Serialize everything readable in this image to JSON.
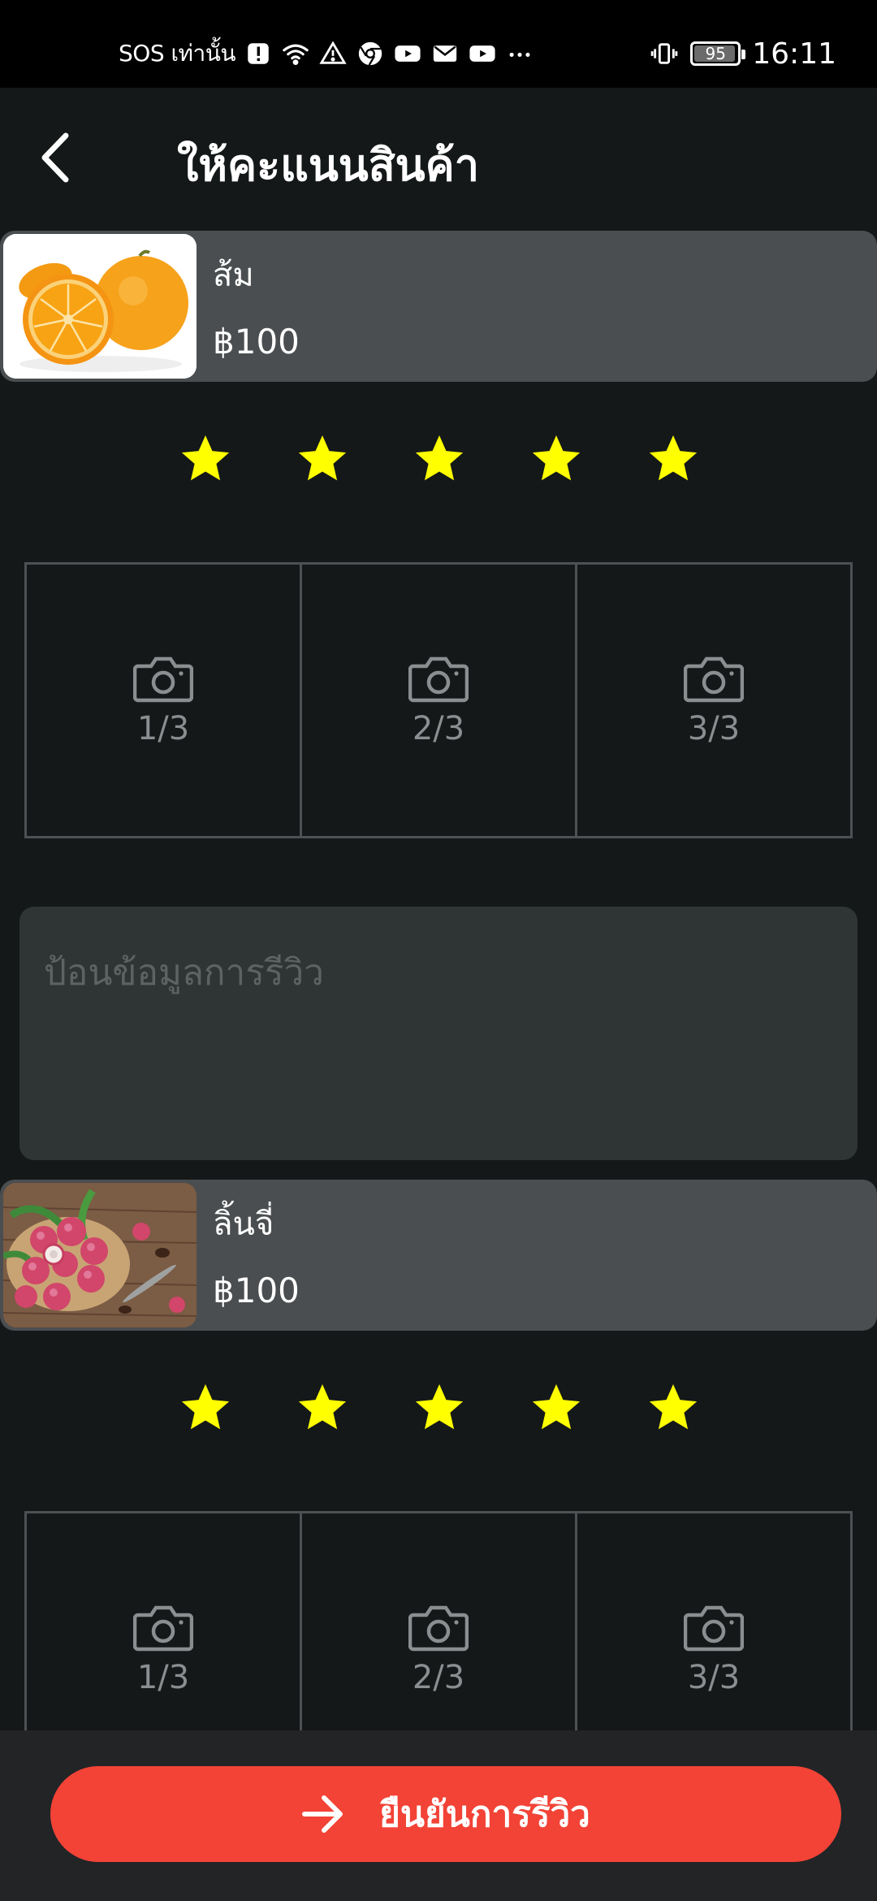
{
  "status_bar": {
    "carrier_text": "SOS เท่านั้น",
    "battery": "95",
    "battery_level": 0.95,
    "time": "16:11",
    "icons": [
      "alert-icon",
      "wifi-icon",
      "warning-icon",
      "chrome-icon",
      "youtube-icon",
      "mail-icon",
      "youtube-icon",
      "more-icon",
      "vibrate-icon",
      "battery-icon"
    ]
  },
  "header": {
    "title": "ให้คะแนนสินค้า",
    "back_icon": "chevron-left-icon"
  },
  "products": [
    {
      "name": "ส้ม",
      "price": "฿100",
      "image": "orange-photo",
      "rating": 5,
      "rating_max": 5,
      "photo_slots": [
        "1/3",
        "2/3",
        "3/3"
      ]
    },
    {
      "name": "ลิ้นจี่",
      "price": "฿100",
      "image": "lychee-photo",
      "rating": 5,
      "rating_max": 5,
      "photo_slots": [
        "1/3",
        "2/3",
        "3/3"
      ]
    }
  ],
  "review": {
    "placeholder": "ป้อนข้อมูลการรีวิว",
    "value": ""
  },
  "confirm": {
    "label": "ยืนยันการรีวิว",
    "icon": "arrow-right-icon"
  },
  "colors": {
    "background": "#141819",
    "card": "#4a4e50",
    "star": "#ffff00",
    "accent": "#f24336",
    "bottom_bar": "#222426"
  }
}
